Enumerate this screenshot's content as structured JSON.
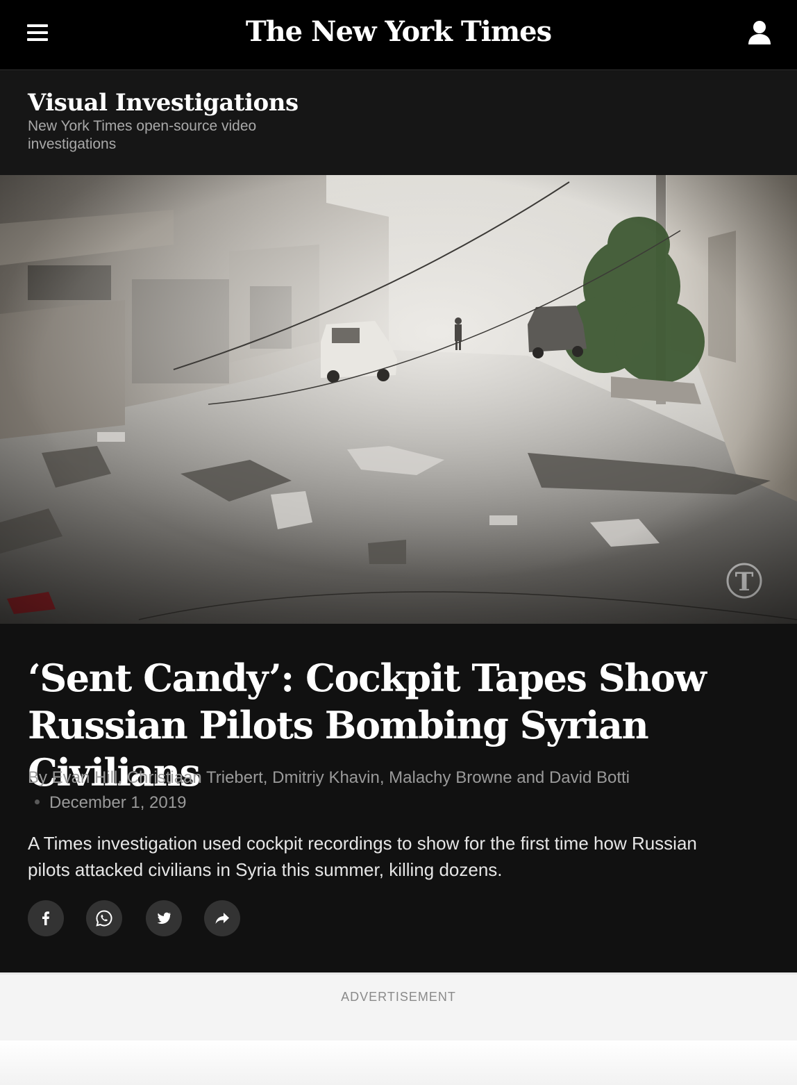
{
  "header": {
    "logo_text": "The New York Times",
    "menu_icon": "hamburger-menu-icon",
    "account_icon": "user-account-icon"
  },
  "section": {
    "title": "Visual Investigations",
    "subtitle": "New York Times open-source video investigations"
  },
  "hero": {
    "image_description": "Street in Syria filled with smoke, rubble and debris after a bombing",
    "watermark_icon": "nyt-t-logo-icon"
  },
  "article": {
    "headline": "‘Sent Candy’: Cockpit Tapes Show Russian Pilots Bombing Syrian Civilians",
    "byline": "By Evan Hill, Christiaan Triebert, Dmitriy Khavin, Malachy Browne and David Botti",
    "date": "December 1, 2019",
    "summary": "A Times investigation used cockpit recordings to show for the first time how Russian pilots attacked civilians in Syria this summer, killing dozens."
  },
  "share": {
    "buttons": [
      {
        "name": "facebook",
        "icon": "facebook-icon"
      },
      {
        "name": "whatsapp",
        "icon": "whatsapp-icon"
      },
      {
        "name": "twitter",
        "icon": "twitter-icon"
      },
      {
        "name": "more",
        "icon": "share-arrow-icon"
      }
    ]
  },
  "advertisement": {
    "label": "ADVERTISEMENT"
  },
  "colors": {
    "masthead_bg": "#000000",
    "page_bg": "#111111",
    "share_button_bg": "#333333",
    "ad_bg": "#f4f4f4"
  }
}
